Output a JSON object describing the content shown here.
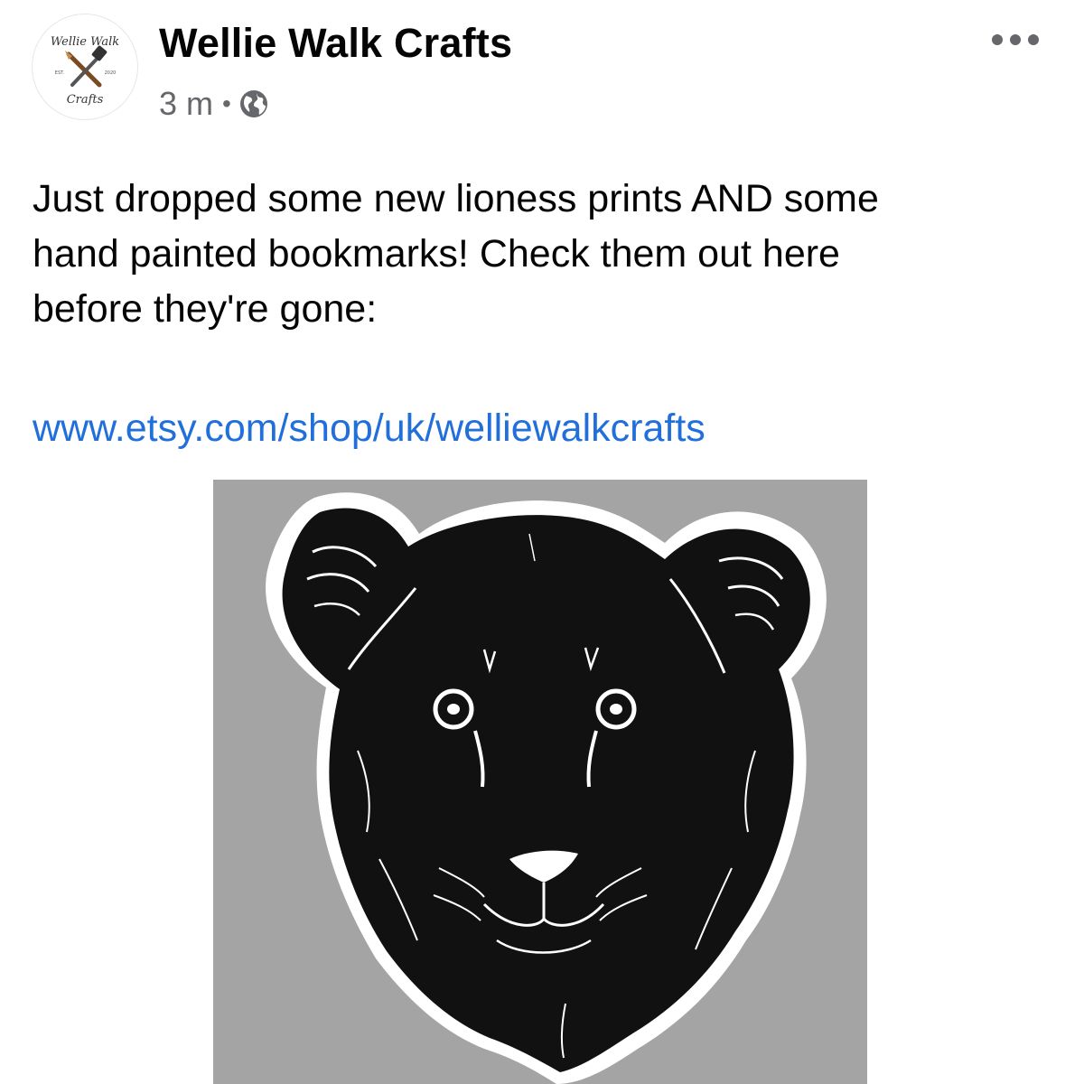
{
  "post": {
    "author": "Wellie Walk Crafts",
    "time": "3 m",
    "separator": "•",
    "audience_icon": "globe-icon",
    "more_icon": "more-options-icon",
    "text_lines": [
      "Just dropped some new lioness prints AND some",
      "hand painted bookmarks! Check them out here",
      "before they're gone:"
    ],
    "link": "www.etsy.com/shop/uk/welliewalkcrafts",
    "image_subject": "lioness-print"
  },
  "avatar": {
    "logo_text_top": "Wellie Walk",
    "logo_text_bottom": "Crafts",
    "est_left": "EST.",
    "est_right": "2020"
  },
  "colors": {
    "link": "#216fdb",
    "meta": "#65676b",
    "photo_background": "#a4a4a4",
    "print_ink": "#111111"
  }
}
